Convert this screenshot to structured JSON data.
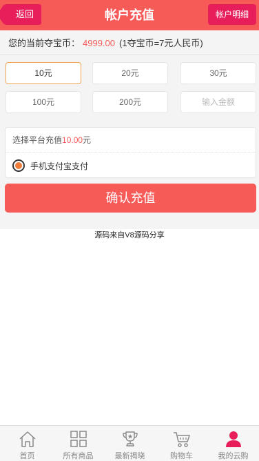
{
  "header": {
    "back_label": "返回",
    "title": "帐户充值",
    "detail_label": "帐户明细"
  },
  "balance": {
    "label": "您的当前夺宝币：",
    "amount": "4999.00",
    "rate": "(1夺宝币=7元人民币)"
  },
  "amounts": [
    "10元",
    "20元",
    "30元",
    "100元",
    "200元"
  ],
  "selected_amount_index": 0,
  "custom_input": {
    "placeholder": "输入金额"
  },
  "payment": {
    "prefix": "选择平台充值",
    "value": "10.00",
    "suffix": "元",
    "method": "手机支付宝支付"
  },
  "confirm_label": "确认充值",
  "footer_note": "源码来自V8源码分享",
  "tabs": [
    {
      "label": "首页",
      "icon": "home-icon"
    },
    {
      "label": "所有商品",
      "icon": "grid-icon"
    },
    {
      "label": "最新揭晓",
      "icon": "trophy-icon"
    },
    {
      "label": "购物车",
      "icon": "cart-icon"
    },
    {
      "label": "我的云购",
      "icon": "user-icon"
    }
  ],
  "colors": {
    "header": "#f75b58",
    "header_button": "#e81e5b",
    "accent_orange": "#f0a04b",
    "active_tab": "#e81e5b"
  }
}
